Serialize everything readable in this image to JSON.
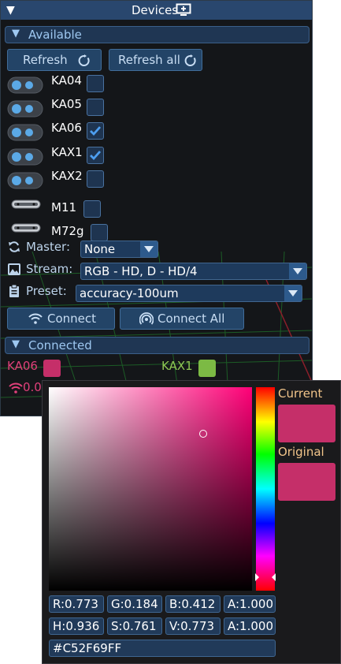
{
  "window": {
    "title": "Devices"
  },
  "available": {
    "header": "Available",
    "refresh_label": "Refresh",
    "refresh_all_label": "Refresh all",
    "devices": [
      {
        "name": "KA04",
        "checked": false,
        "kind": "toggle"
      },
      {
        "name": "KA05",
        "checked": false,
        "kind": "toggle"
      },
      {
        "name": "KA06",
        "checked": true,
        "kind": "toggle"
      },
      {
        "name": "KAX1",
        "checked": true,
        "kind": "toggle"
      },
      {
        "name": "KAX2",
        "checked": false,
        "kind": "toggle"
      },
      {
        "name": "M11",
        "checked": false,
        "kind": "camera"
      },
      {
        "name": "M72g",
        "checked": false,
        "kind": "camera"
      }
    ],
    "master_label": "Master:",
    "master_value": "None",
    "stream_label": "Stream:",
    "stream_value": "RGB - HD, D - HD/4",
    "preset_label": "Preset:",
    "preset_value": "accuracy-100um",
    "connect_label": "Connect",
    "connect_all_label": "Connect All"
  },
  "connected": {
    "header": "Connected",
    "items": [
      {
        "name": "KA06",
        "color": "#c52f69",
        "label_color": "#e0407a"
      },
      {
        "name": "KAX1",
        "color": "#7cba44",
        "label_color": "#8fc653"
      }
    ],
    "signal_text": "0.0"
  },
  "color_picker": {
    "current_label": "Current",
    "original_label": "Original",
    "current_color": "#c52f69",
    "original_color": "#c52f69",
    "hue_color": "#ff0077",
    "rgba": [
      "R:0.773",
      "G:0.184",
      "B:0.412",
      "A:1.000"
    ],
    "hsva": [
      "H:0.936",
      "S:0.761",
      "V:0.773",
      "A:1.000"
    ],
    "hex": "#C52F69FF",
    "saturation": 0.761,
    "value": 0.773,
    "hue": 0.936
  },
  "colors": {
    "accent": "#29476e",
    "check": "#4d9ef0"
  }
}
